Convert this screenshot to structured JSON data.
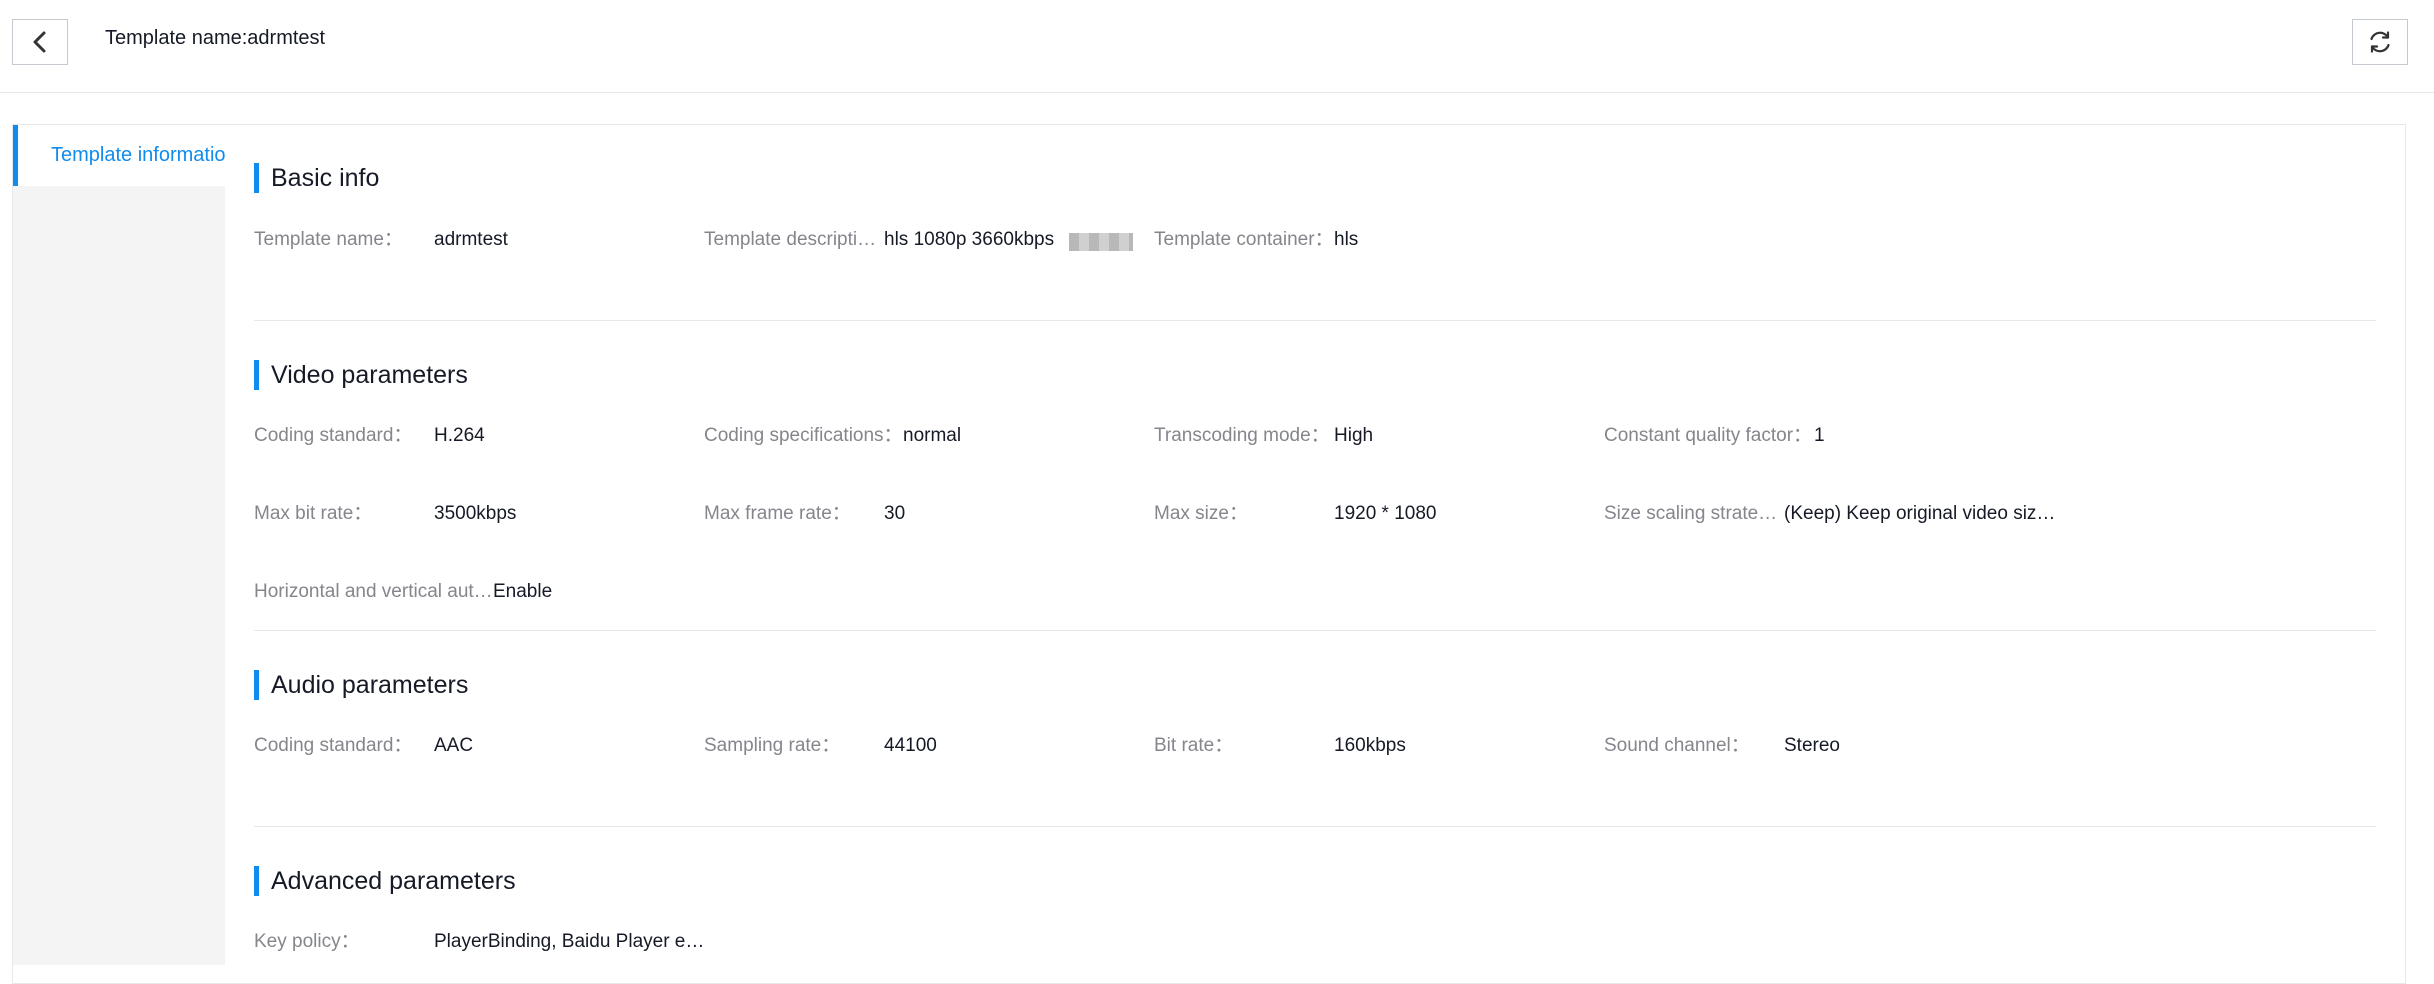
{
  "header": {
    "title": "Template name:adrmtest"
  },
  "sidebar": {
    "items": [
      {
        "label": "Template information"
      }
    ]
  },
  "sections": {
    "basic": {
      "title": "Basic info",
      "name_label": "Template name：",
      "name_value": "adrmtest",
      "desc_label": "Template descripti…",
      "desc_value": "hls 1080p 3660kbps",
      "container_label": "Template container：",
      "container_value": "hls"
    },
    "video": {
      "title": "Video parameters",
      "coding_standard_label": "Coding standard：",
      "coding_standard_value": "H.264",
      "coding_spec_label": "Coding specifications：",
      "coding_spec_value": "normal",
      "transcoding_mode_label": "Transcoding mode：",
      "transcoding_mode_value": "High",
      "cqf_label": "Constant quality factor：",
      "cqf_value": "1",
      "max_bitrate_label": "Max bit rate：",
      "max_bitrate_value": "3500kbps",
      "max_framerate_label": "Max frame rate：",
      "max_framerate_value": "30",
      "max_size_label": "Max size：",
      "max_size_value": "1920 * 1080",
      "scaling_label": "Size scaling strate…",
      "scaling_value": "(Keep) Keep original video siz…",
      "hv_auto_label": "Horizontal and vertical aut…",
      "hv_auto_value": "Enable"
    },
    "audio": {
      "title": "Audio parameters",
      "coding_standard_label": "Coding standard：",
      "coding_standard_value": "AAC",
      "sampling_rate_label": "Sampling rate：",
      "sampling_rate_value": "44100",
      "bitrate_label": "Bit rate：",
      "bitrate_value": "160kbps",
      "channel_label": "Sound channel：",
      "channel_value": "Stereo"
    },
    "advanced": {
      "title": "Advanced parameters",
      "key_policy_label": "Key policy：",
      "key_policy_value": "PlayerBinding, Baidu Player e…"
    }
  },
  "colors": {
    "accent": "#108cee",
    "label": "#84868c",
    "text": "#151a26",
    "border": "#e6e8eb"
  },
  "icons": {
    "back": "chevron-left-icon",
    "refresh": "refresh-icon"
  }
}
